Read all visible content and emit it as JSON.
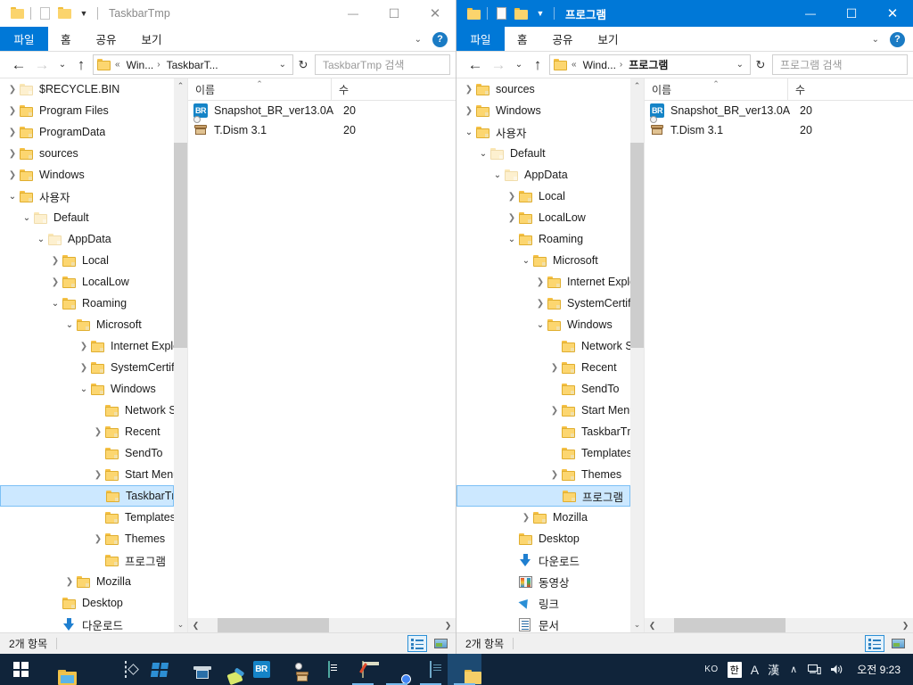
{
  "windows": [
    {
      "id": "left",
      "active": false,
      "title": "TaskbarTmp",
      "ribbon": {
        "file": "파일",
        "tabs": [
          "홈",
          "공유",
          "보기"
        ],
        "help": "?"
      },
      "address": {
        "root": "Win...",
        "current": "TaskbarT...",
        "separator": "›",
        "prefix": "«"
      },
      "search": {
        "placeholder": "TaskbarTmp 검색"
      },
      "columns": {
        "name": "이름",
        "date": "수"
      },
      "files": [
        {
          "icon": "br-icon",
          "name": "Snapshot_BR_ver13.0A",
          "date": "20"
        },
        {
          "icon": "box-gear-icon",
          "name": "T.Dism 3.1",
          "date": "20"
        }
      ],
      "status": {
        "items": "2개 항목"
      },
      "tree": [
        {
          "label": "$RECYCLE.BIN",
          "indent": 1,
          "expander": "collapsed",
          "faded": true
        },
        {
          "label": "Program Files",
          "indent": 1,
          "expander": "collapsed",
          "faded": false
        },
        {
          "label": "ProgramData",
          "indent": 1,
          "expander": "collapsed",
          "faded": false
        },
        {
          "label": "sources",
          "indent": 1,
          "expander": "collapsed",
          "faded": false
        },
        {
          "label": "Windows",
          "indent": 1,
          "expander": "collapsed",
          "faded": false
        },
        {
          "label": "사용자",
          "indent": 1,
          "expander": "expanded",
          "faded": false
        },
        {
          "label": "Default",
          "indent": 2,
          "expander": "expanded",
          "faded": true
        },
        {
          "label": "AppData",
          "indent": 3,
          "expander": "expanded",
          "faded": true
        },
        {
          "label": "Local",
          "indent": 4,
          "expander": "collapsed",
          "faded": false
        },
        {
          "label": "LocalLow",
          "indent": 4,
          "expander": "collapsed",
          "faded": false
        },
        {
          "label": "Roaming",
          "indent": 4,
          "expander": "expanded",
          "faded": false
        },
        {
          "label": "Microsoft",
          "indent": 5,
          "expander": "expanded",
          "faded": false
        },
        {
          "label": "Internet Explorer",
          "indent": 6,
          "expander": "collapsed",
          "faded": false
        },
        {
          "label": "SystemCertificat",
          "indent": 6,
          "expander": "collapsed",
          "faded": false
        },
        {
          "label": "Windows",
          "indent": 6,
          "expander": "expanded",
          "faded": false
        },
        {
          "label": "Network Short",
          "indent": 7,
          "expander": "none",
          "faded": false
        },
        {
          "label": "Recent",
          "indent": 7,
          "expander": "collapsed",
          "faded": false
        },
        {
          "label": "SendTo",
          "indent": 7,
          "expander": "none",
          "faded": false
        },
        {
          "label": "Start Menu",
          "indent": 7,
          "expander": "collapsed",
          "faded": false
        },
        {
          "label": "TaskbarTmp",
          "indent": 7,
          "expander": "none",
          "faded": false,
          "selected": true
        },
        {
          "label": "Templates",
          "indent": 7,
          "expander": "none",
          "faded": false
        },
        {
          "label": "Themes",
          "indent": 7,
          "expander": "collapsed",
          "faded": false
        },
        {
          "label": "프로그램",
          "indent": 7,
          "expander": "none",
          "faded": false
        },
        {
          "label": "Mozilla",
          "indent": 5,
          "expander": "collapsed",
          "faded": false
        },
        {
          "label": "Desktop",
          "indent": 4,
          "expander": "none",
          "faded": false
        },
        {
          "label": "다운로드",
          "indent": 4,
          "expander": "none",
          "icon": "download-icon"
        }
      ]
    },
    {
      "id": "right",
      "active": true,
      "title": "프로그램",
      "ribbon": {
        "file": "파일",
        "tabs": [
          "홈",
          "공유",
          "보기"
        ],
        "help": "?"
      },
      "address": {
        "root": "Wind...",
        "current": "프로그램",
        "separator": "›",
        "prefix": "«"
      },
      "search": {
        "placeholder": "프로그램 검색"
      },
      "columns": {
        "name": "이름",
        "date": "수"
      },
      "files": [
        {
          "icon": "br-icon",
          "name": "Snapshot_BR_ver13.0A",
          "date": "20"
        },
        {
          "icon": "box-gear-icon",
          "name": "T.Dism 3.1",
          "date": "20"
        }
      ],
      "status": {
        "items": "2개 항목"
      },
      "tree": [
        {
          "label": "sources",
          "indent": 1,
          "expander": "collapsed",
          "faded": false
        },
        {
          "label": "Windows",
          "indent": 1,
          "expander": "collapsed",
          "faded": false
        },
        {
          "label": "사용자",
          "indent": 1,
          "expander": "expanded",
          "faded": false
        },
        {
          "label": "Default",
          "indent": 2,
          "expander": "expanded",
          "faded": true
        },
        {
          "label": "AppData",
          "indent": 3,
          "expander": "expanded",
          "faded": true
        },
        {
          "label": "Local",
          "indent": 4,
          "expander": "collapsed",
          "faded": false
        },
        {
          "label": "LocalLow",
          "indent": 4,
          "expander": "collapsed",
          "faded": false
        },
        {
          "label": "Roaming",
          "indent": 4,
          "expander": "expanded",
          "faded": false
        },
        {
          "label": "Microsoft",
          "indent": 5,
          "expander": "expanded",
          "faded": false
        },
        {
          "label": "Internet Explorer",
          "indent": 6,
          "expander": "collapsed",
          "faded": false
        },
        {
          "label": "SystemCertificat",
          "indent": 6,
          "expander": "collapsed",
          "faded": false
        },
        {
          "label": "Windows",
          "indent": 6,
          "expander": "expanded",
          "faded": false
        },
        {
          "label": "Network Short",
          "indent": 7,
          "expander": "none",
          "faded": false
        },
        {
          "label": "Recent",
          "indent": 7,
          "expander": "collapsed",
          "faded": false
        },
        {
          "label": "SendTo",
          "indent": 7,
          "expander": "none",
          "faded": false
        },
        {
          "label": "Start Menu",
          "indent": 7,
          "expander": "collapsed",
          "faded": false
        },
        {
          "label": "TaskbarTmp",
          "indent": 7,
          "expander": "none",
          "faded": false
        },
        {
          "label": "Templates",
          "indent": 7,
          "expander": "none",
          "faded": false
        },
        {
          "label": "Themes",
          "indent": 7,
          "expander": "collapsed",
          "faded": false
        },
        {
          "label": "프로그램",
          "indent": 7,
          "expander": "none",
          "faded": false,
          "selected": true
        },
        {
          "label": "Mozilla",
          "indent": 5,
          "expander": "collapsed",
          "faded": false
        },
        {
          "label": "Desktop",
          "indent": 4,
          "expander": "none",
          "faded": false
        },
        {
          "label": "다운로드",
          "indent": 4,
          "expander": "none",
          "icon": "download-icon"
        },
        {
          "label": "동영상",
          "indent": 4,
          "expander": "none",
          "icon": "video-icon"
        },
        {
          "label": "링크",
          "indent": 4,
          "expander": "none",
          "icon": "link-icon"
        },
        {
          "label": "문서",
          "indent": 4,
          "expander": "none",
          "icon": "document-icon"
        }
      ]
    }
  ],
  "caption": {
    "minimize": "—",
    "maximize": "☐",
    "close": "✕"
  },
  "taskbar": {
    "start": "start-button",
    "items": [
      {
        "name": "file-explorer",
        "icon": "explorer-icon",
        "open": false,
        "active": false
      },
      {
        "name": "firefox",
        "icon": "firefox-icon",
        "open": false,
        "active": false
      },
      {
        "name": "snipping-tool",
        "icon": "selection-icon",
        "open": false,
        "active": false
      },
      {
        "name": "windows-app",
        "icon": "windows-logo-icon",
        "open": false,
        "active": false
      },
      {
        "name": "remote-desktop",
        "icon": "laptop-icon",
        "open": false,
        "active": false
      },
      {
        "name": "paint-app",
        "icon": "paint-icon",
        "open": false,
        "active": false
      },
      {
        "name": "macrium-reflect",
        "icon": "br-icon",
        "open": false,
        "active": false
      },
      {
        "name": "dism-tool",
        "icon": "box-gear-icon",
        "open": false,
        "active": false
      },
      {
        "name": "teal-app",
        "icon": "teal-doc-icon",
        "open": false,
        "active": false
      },
      {
        "name": "notepad-plus",
        "icon": "notepad-pen-icon",
        "open": true,
        "active": false
      },
      {
        "name": "chrome",
        "icon": "chrome-icon",
        "open": true,
        "active": false
      },
      {
        "name": "blue-notepad",
        "icon": "blue-note-icon",
        "open": true,
        "active": false
      },
      {
        "name": "explorer-window",
        "icon": "folder-icon",
        "open": true,
        "active": true
      }
    ],
    "tray": {
      "lang": "KO",
      "ime_mode": "한",
      "ime_alpha": "A",
      "ime_hanja": "漢",
      "chevron": "∧",
      "network": "network-icon",
      "volume": "volume-icon",
      "clock_period": "오전",
      "clock_time": "9:23"
    }
  },
  "colors": {
    "accent": "#0078d7",
    "selection": "#cce8ff",
    "taskbar": "#10243a",
    "folder": "#fcd670"
  }
}
